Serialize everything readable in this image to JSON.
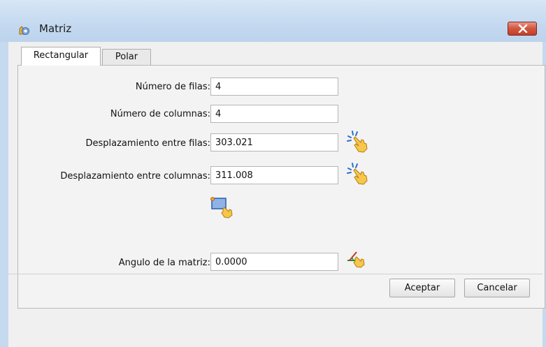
{
  "window": {
    "title": "Matriz",
    "close_icon": "close-icon"
  },
  "tabs": [
    {
      "label": "Rectangular",
      "active": true
    },
    {
      "label": "Polar",
      "active": false
    }
  ],
  "form": {
    "rows_label": "Número de filas:",
    "rows_value": "4",
    "cols_label": "Número de columnas:",
    "cols_value": "4",
    "row_spacing_label": "Desplazamiento entre filas:",
    "row_spacing_value": "303.021",
    "col_spacing_label": "Desplazamiento entre columnas:",
    "col_spacing_value": "311.008",
    "angle_label": "Angulo de la matriz:",
    "angle_value": "0.0000"
  },
  "icons": {
    "pick_distance": "pick-point-hand-icon",
    "pick_rectangle": "pick-rectangle-icon",
    "pick_angle": "pick-angle-icon"
  },
  "buttons": {
    "accept": "Aceptar",
    "cancel": "Cancelar"
  },
  "colors": {
    "titlebar": "#c4d9f0",
    "close_button": "#d2553e",
    "panel": "#f3f3f3"
  }
}
